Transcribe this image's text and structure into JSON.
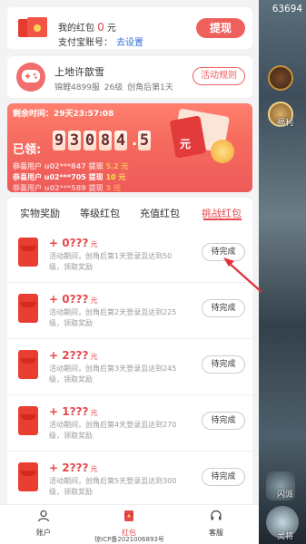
{
  "game": {
    "counter": "63694",
    "badge1": "福利",
    "badge2": "闪派",
    "badge3": "灵将"
  },
  "wallet": {
    "label": "我的红包",
    "amount": "0",
    "unit": "元",
    "alipay_label": "支付宝账号：",
    "alipay_link": "去设置",
    "withdraw": "提现"
  },
  "user": {
    "name": "上地许歆雪",
    "server": "锦鲤4899服",
    "level": "26级",
    "created": "创角后第1天",
    "rules_button": "活动规则"
  },
  "banner": {
    "timer": "剩余时间：29天23:57:08",
    "claimed_label": "已领:",
    "digits": [
      "9",
      "3",
      "0",
      "8",
      "4",
      ".",
      "5"
    ],
    "unit": "元",
    "ticker": [
      {
        "prefix": "恭喜用户 u02***847 提现",
        "amount": "5.2",
        "unit": "元"
      },
      {
        "prefix": "恭喜用户 u02***705 提现",
        "amount": "10",
        "unit": "元"
      },
      {
        "prefix": "恭喜用户 u02***589 提现",
        "amount": "3",
        "unit": "元"
      }
    ]
  },
  "tabs": [
    "实物奖励",
    "等级红包",
    "充值红包",
    "挑战红包"
  ],
  "active_tab": 3,
  "items": [
    {
      "amount": "+ 0???",
      "unit": "元",
      "desc": "活动期间，创角后第1天登录且达到50级，领取奖励",
      "button": "待完成"
    },
    {
      "amount": "+ 0???",
      "unit": "元",
      "desc": "活动期间，创角后第2天登录且达到225级，领取奖励",
      "button": "待完成"
    },
    {
      "amount": "+ 2???",
      "unit": "元",
      "desc": "活动期间，创角后第3天登录且达到245级，领取奖励",
      "button": "待完成"
    },
    {
      "amount": "+ 1???",
      "unit": "元",
      "desc": "活动期间，创角后第4天登录且达到270级，领取奖励",
      "button": "待完成"
    },
    {
      "amount": "+ 2???",
      "unit": "元",
      "desc": "活动期间，创角后第5天登录且达到300级，领取奖励",
      "button": "待完成"
    }
  ],
  "nav": [
    {
      "label": "账户",
      "icon": "user-icon"
    },
    {
      "label": "红包",
      "icon": "red-packet-icon"
    },
    {
      "label": "客服",
      "icon": "headset-icon"
    }
  ],
  "icp": "琼ICP备2021006893号",
  "colors": {
    "accent": "#e5484d",
    "link": "#2f6fd6",
    "banner": "#f56a5e"
  }
}
